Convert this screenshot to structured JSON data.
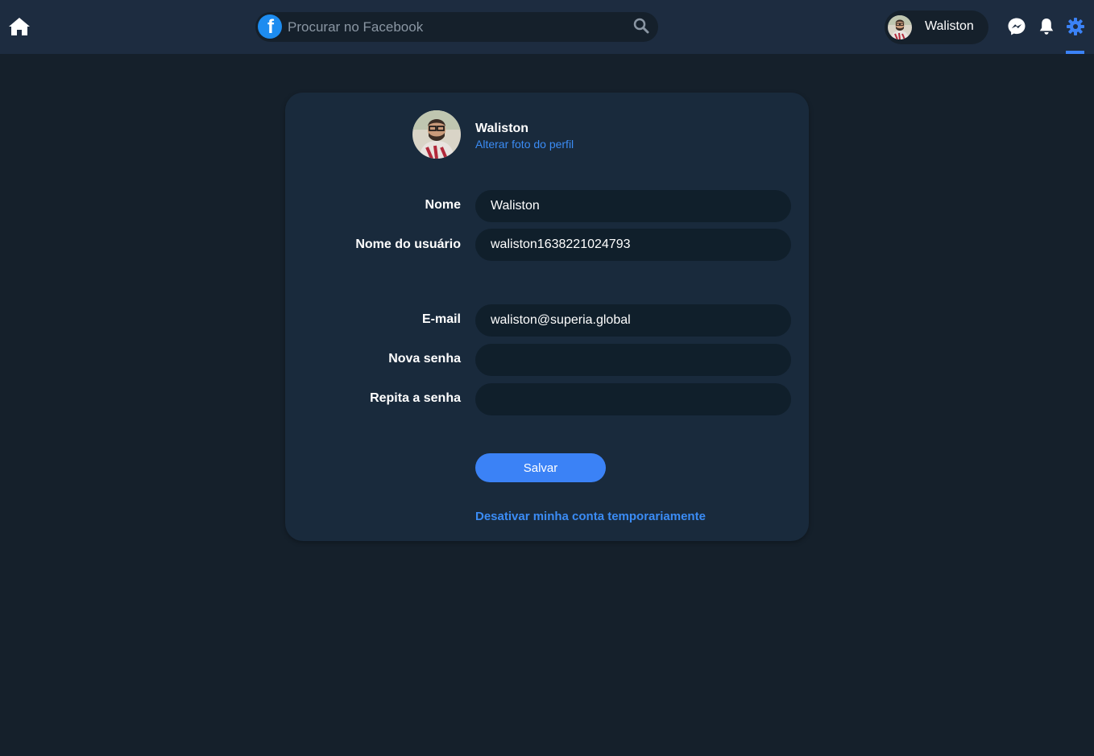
{
  "topbar": {
    "search": {
      "placeholder": "Procurar no Facebook",
      "value": ""
    },
    "user": {
      "name": "Waliston"
    },
    "icons": {
      "home": "home-icon",
      "brand": "facebook-logo-icon",
      "search": "search-icon",
      "messenger": "messenger-icon",
      "notifications": "bell-icon",
      "settings": "gear-icon"
    },
    "active_nav": "settings"
  },
  "profile": {
    "name": "Waliston",
    "change_photo_label": "Alterar foto do perfil"
  },
  "form": {
    "name": {
      "label": "Nome",
      "value": "Waliston"
    },
    "username": {
      "label": "Nome do usuário",
      "value": "waliston1638221024793"
    },
    "email": {
      "label": "E-mail",
      "value": "waliston@superia.global"
    },
    "new_password": {
      "label": "Nova senha",
      "value": ""
    },
    "repeat_password": {
      "label": "Repita a senha",
      "value": ""
    },
    "save_label": "Salvar",
    "deactivate_label": "Desativar minha conta temporariamente"
  },
  "colors": {
    "background": "#15202b",
    "topbar": "#1d2c40",
    "card": "#192a3c",
    "input": "#101f2b",
    "accent": "#3b82f6",
    "link": "#3b8cf5"
  }
}
